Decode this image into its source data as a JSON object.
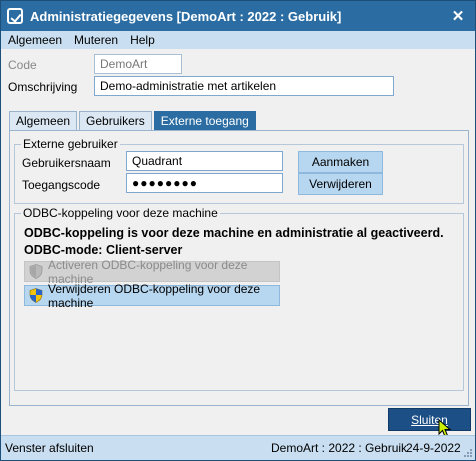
{
  "window": {
    "title": "Administratiegegevens [DemoArt : 2022 : Gebruik]",
    "close_glyph": "✕"
  },
  "menu": [
    "Algemeen",
    "Muteren",
    "Help"
  ],
  "form": {
    "code_label": "Code",
    "code_value": "DemoArt",
    "omschrijving_label": "Omschrijving",
    "omschrijving_value": "Demo-administratie met artikelen"
  },
  "tabs": [
    "Algemeen",
    "Gebruikers",
    "Externe toegang"
  ],
  "active_tab": "Externe toegang",
  "externe_gebruiker": {
    "title": "Externe gebruiker",
    "gebruikersnaam_label": "Gebruikersnaam",
    "gebruikersnaam_value": "Quadrant",
    "toegangscode_label": "Toegangscode",
    "toegangscode_value": "●●●●●●●●",
    "aanmaken_label": "Aanmaken",
    "verwijderen_label": "Verwijderen"
  },
  "odbc": {
    "title": "ODBC-koppeling voor deze machine",
    "status_line": "ODBC-koppeling is voor deze machine en administratie al geactiveerd.",
    "mode_line": "ODBC-mode: Client-server",
    "activeren_label": "Activeren ODBC-koppeling voor deze machine",
    "verwijderen_label": "Verwijderen ODBC-koppeling voor deze machine"
  },
  "sluiten_label": "Sluiten",
  "status": {
    "left": "Venster afsluiten",
    "middle": "DemoArt : 2022 : Gebruik",
    "right": "24-9-2022"
  },
  "colors": {
    "titlebar": "#2b6da3",
    "accent_button": "#b7d6ef",
    "primary_button": "#1c4f86",
    "statusbar": "#c9def0"
  }
}
